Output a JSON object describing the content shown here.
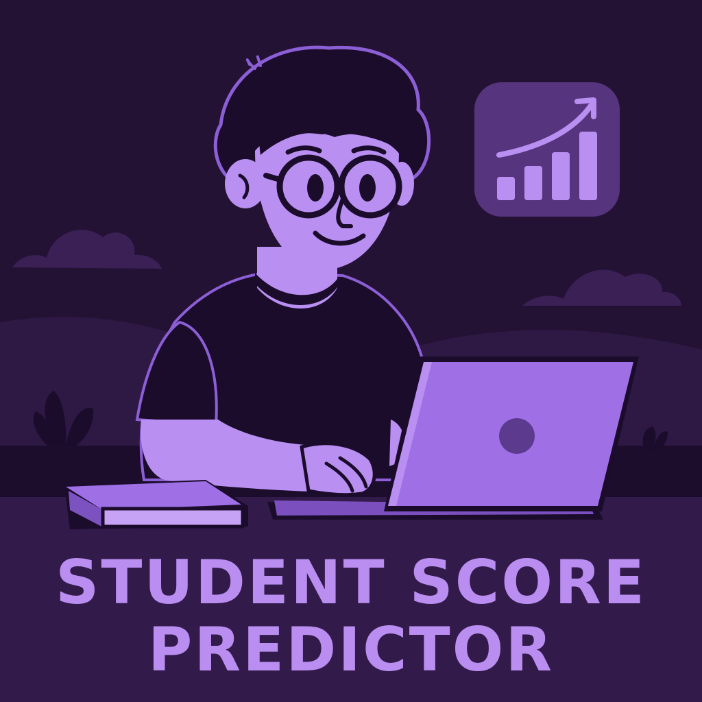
{
  "title": {
    "line1": "STUDENT SCORE",
    "line2": "PREDICTOR"
  },
  "icons": {
    "chart": "growth-chart-icon",
    "laptop": "laptop",
    "book": "book"
  },
  "colors": {
    "background": "#241235",
    "sky_band": "#2a1540",
    "hill_dark": "#2f1a45",
    "ground": "#341b4d",
    "skin": "#b990f2",
    "shirt": "#1b0c2c",
    "hair": "#1b0c2c",
    "outline": "#9a6ae0",
    "laptop": "#9f6fe6",
    "laptop_logo": "#5c3a8e",
    "icon_bg": "#57347e",
    "icon_fg": "#b990f2",
    "title": "#b98ef0"
  }
}
